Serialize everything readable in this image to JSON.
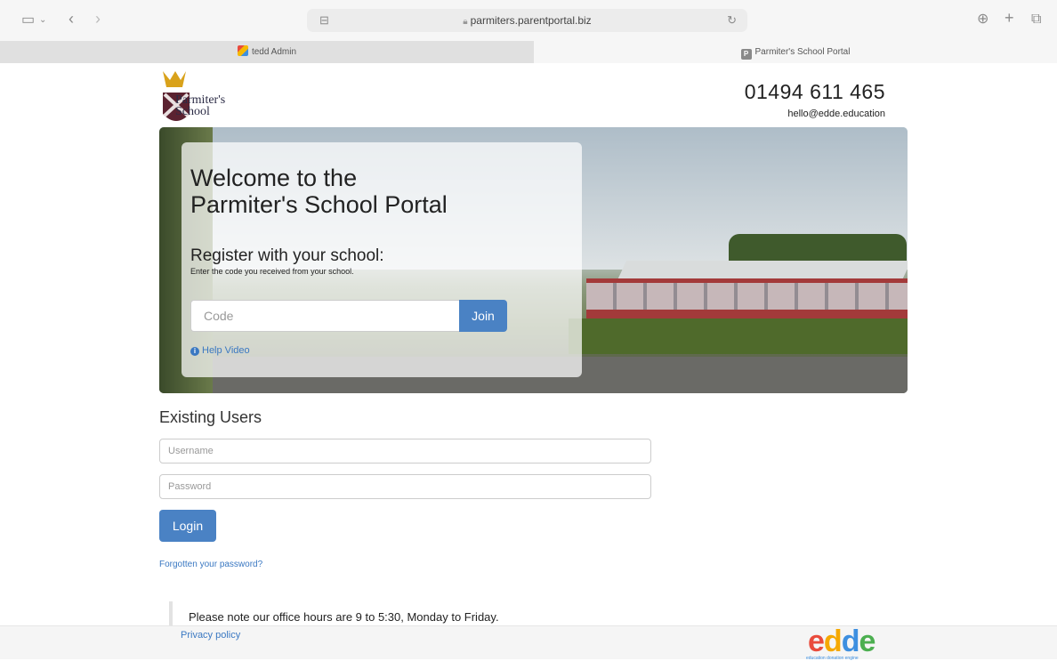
{
  "browser": {
    "url": "parmiters.parentportal.biz",
    "tabs": [
      {
        "label": "tedd Admin",
        "active": false
      },
      {
        "label": "Parmiter's School Portal",
        "active": true
      }
    ]
  },
  "header": {
    "logo_text_line1": "Parmiter's",
    "logo_text_line2": "School",
    "phone": "01494 611 465",
    "email": "hello@edde.education"
  },
  "hero": {
    "title": "Welcome to the Parmiter's School Portal",
    "register_title": "Register with your school:",
    "register_subtitle": "Enter the code you received from your school.",
    "code_placeholder": "Code",
    "join_label": "Join",
    "help_label": "Help Video"
  },
  "login": {
    "heading": "Existing Users",
    "username_placeholder": "Username",
    "password_placeholder": "Password",
    "login_label": "Login",
    "forgot_label": "Forgotten your password?"
  },
  "notice": "Please note our office hours are 9 to 5:30, Monday to Friday.",
  "footer": {
    "privacy_label": "Privacy policy",
    "brand_letters": [
      "e",
      "d",
      "d",
      "e"
    ],
    "brand_tagline": "education donation engine"
  },
  "colors": {
    "accent": "#4a82c4",
    "link": "#3a78c2"
  }
}
